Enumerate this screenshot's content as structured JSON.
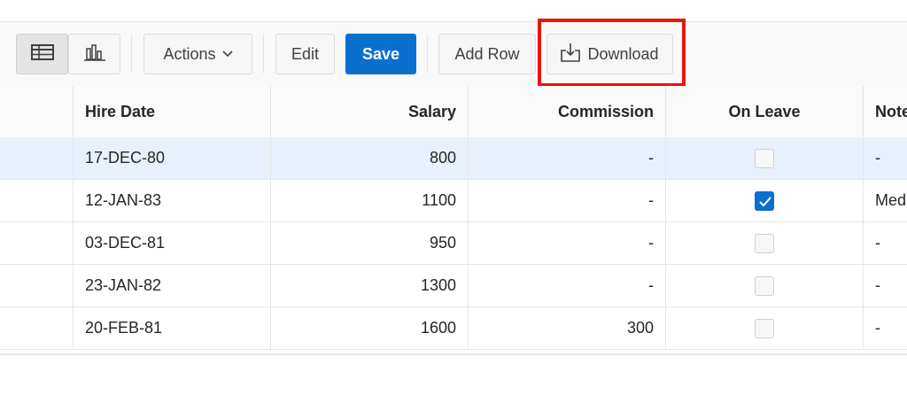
{
  "toolbar": {
    "view_grid_icon": "grid-view-icon",
    "view_chart_icon": "chart-view-icon",
    "actions_label": "Actions",
    "edit_label": "Edit",
    "save_label": "Save",
    "add_row_label": "Add Row",
    "download_label": "Download",
    "colors": {
      "save_bg": "#0a70d0",
      "highlight": "#e8150b"
    }
  },
  "grid": {
    "columns": [
      "Hire Date",
      "Salary",
      "Commission",
      "On Leave",
      "Notes"
    ],
    "columns_visible_text": [
      "Hire Date",
      "Salary",
      "Commission",
      "On Leave",
      "Note"
    ],
    "rows": [
      {
        "hire_date": "17-DEC-80",
        "salary": "800",
        "commission": "-",
        "on_leave": false,
        "notes": "-",
        "selected": true
      },
      {
        "hire_date": "12-JAN-83",
        "salary": "1100",
        "commission": "-",
        "on_leave": true,
        "notes": "Med",
        "selected": false
      },
      {
        "hire_date": "03-DEC-81",
        "salary": "950",
        "commission": "-",
        "on_leave": false,
        "notes": "-",
        "selected": false
      },
      {
        "hire_date": "23-JAN-82",
        "salary": "1300",
        "commission": "-",
        "on_leave": false,
        "notes": "-",
        "selected": false
      },
      {
        "hire_date": "20-FEB-81",
        "salary": "1600",
        "commission": "300",
        "on_leave": false,
        "notes": "-",
        "selected": false
      }
    ]
  }
}
